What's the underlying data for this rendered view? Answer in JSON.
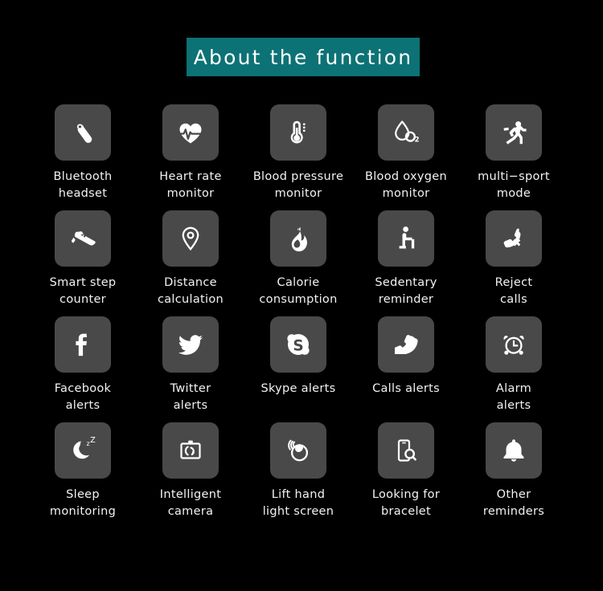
{
  "header": {
    "title": "About  the  function",
    "banner_color": "#0d7275",
    "title_color": "#ffffff"
  },
  "theme": {
    "background": "#000000",
    "tile_color": "#494949",
    "icon_color": "#ffffff",
    "label_color": "#f2f2f2"
  },
  "grid": {
    "columns": 5,
    "rows": 4,
    "items": [
      {
        "icon": "bluetooth-headset-icon",
        "label": "Bluetooth\nheadset"
      },
      {
        "icon": "heart-rate-icon",
        "label": "Heart rate\nmonitor"
      },
      {
        "icon": "thermometer-icon",
        "label": "Blood pressure\nmonitor"
      },
      {
        "icon": "blood-oxygen-icon",
        "label": "Blood oxygen\nmonitor"
      },
      {
        "icon": "running-man-icon",
        "label": "multi−sport\nmode"
      },
      {
        "icon": "sneaker-icon",
        "label": "Smart step\ncounter"
      },
      {
        "icon": "map-pin-icon",
        "label": "Distance\ncalculation"
      },
      {
        "icon": "flame-icon",
        "label": "Calorie\nconsumption"
      },
      {
        "icon": "sitting-person-icon",
        "label": "Sedentary\nreminder"
      },
      {
        "icon": "reject-call-icon",
        "label": "Reject\ncalls"
      },
      {
        "icon": "facebook-icon",
        "label": "Facebook\nalerts"
      },
      {
        "icon": "twitter-icon",
        "label": "Twitter\nalerts"
      },
      {
        "icon": "skype-icon",
        "label": "Skype alerts"
      },
      {
        "icon": "incoming-call-icon",
        "label": "Calls alerts"
      },
      {
        "icon": "alarm-clock-icon",
        "label": "Alarm\nalerts"
      },
      {
        "icon": "moon-sleep-icon",
        "label": "Sleep\nmonitoring"
      },
      {
        "icon": "camera-remote-icon",
        "label": "Intelligent\ncamera"
      },
      {
        "icon": "lift-wrist-icon",
        "label": "Lift hand\nlight screen"
      },
      {
        "icon": "find-bracelet-icon",
        "label": "Looking for\nbracelet"
      },
      {
        "icon": "bell-icon",
        "label": "Other\nreminders"
      }
    ]
  }
}
